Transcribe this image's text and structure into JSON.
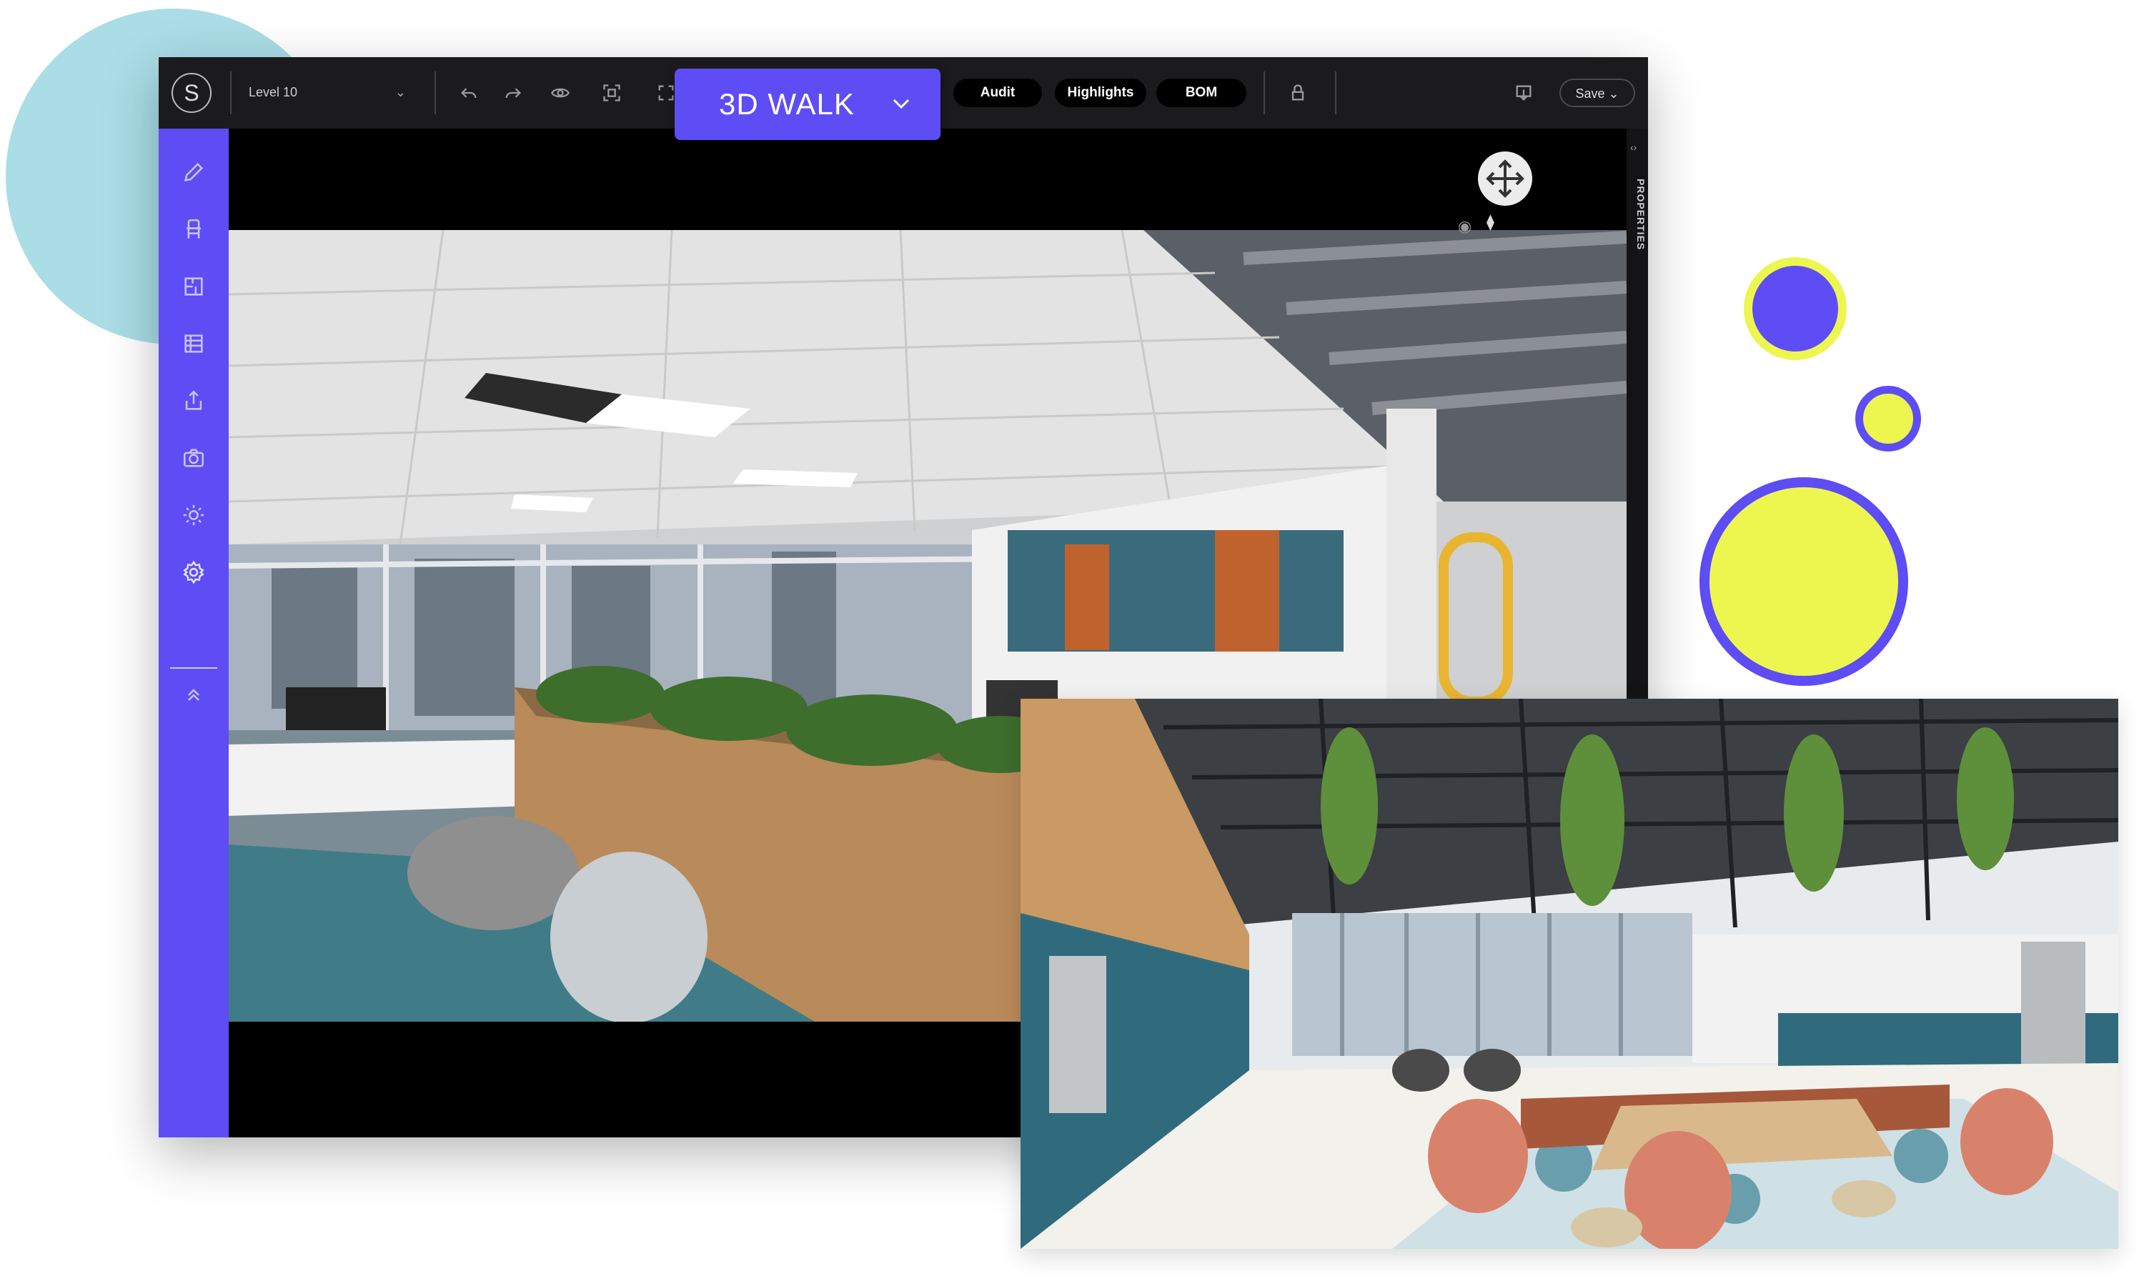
{
  "toolbar": {
    "logo_letter": "S",
    "level_select": "Level 10",
    "mode_button": "3D WALK",
    "audit_label": "Audit",
    "highlights_label": "Highlights",
    "bom_label": "BOM",
    "save_label": "Save ⌄"
  },
  "right_panel": {
    "properties_label": "PROPERTIES"
  },
  "colors": {
    "accent": "#5e4cf5",
    "yellow": "#ecf64f",
    "light_blue": "#aadde6",
    "topbar_bg": "#1b1b1d"
  },
  "sidebar_icons": [
    "pencil-icon",
    "chair-icon",
    "floorplan-icon",
    "table-grid-icon",
    "share-icon",
    "camera-icon",
    "light-icon",
    "settings-icon",
    "collapse-up-icon"
  ]
}
